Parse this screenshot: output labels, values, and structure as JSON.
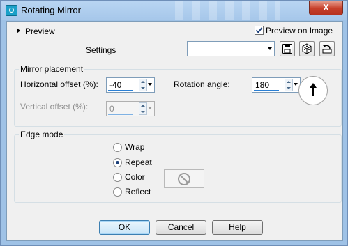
{
  "window": {
    "title": "Rotating Mirror",
    "close_label": "X"
  },
  "preview": {
    "label": "Preview",
    "preview_on_image_label": "Preview on Image",
    "preview_on_image_checked": true
  },
  "settings": {
    "label": "Settings",
    "value": ""
  },
  "mirror_placement": {
    "title": "Mirror placement",
    "horizontal_offset_label": "Horizontal offset (%):",
    "horizontal_offset_value": "-40",
    "rotation_angle_label": "Rotation angle:",
    "rotation_angle_value": "180",
    "vertical_offset_label": "Vertical offset (%):",
    "vertical_offset_value": "0"
  },
  "edge_mode": {
    "title": "Edge mode",
    "options": [
      "Wrap",
      "Repeat",
      "Color",
      "Reflect"
    ],
    "selected": "Repeat"
  },
  "buttons": {
    "ok": "OK",
    "cancel": "Cancel",
    "help": "Help"
  },
  "icons": {
    "save": "save-preset-icon",
    "manage": "manage-presets-icon",
    "reset": "reset-icon",
    "no_color": "no-color-icon",
    "rotation_dial": "rotation-dial-icon"
  }
}
